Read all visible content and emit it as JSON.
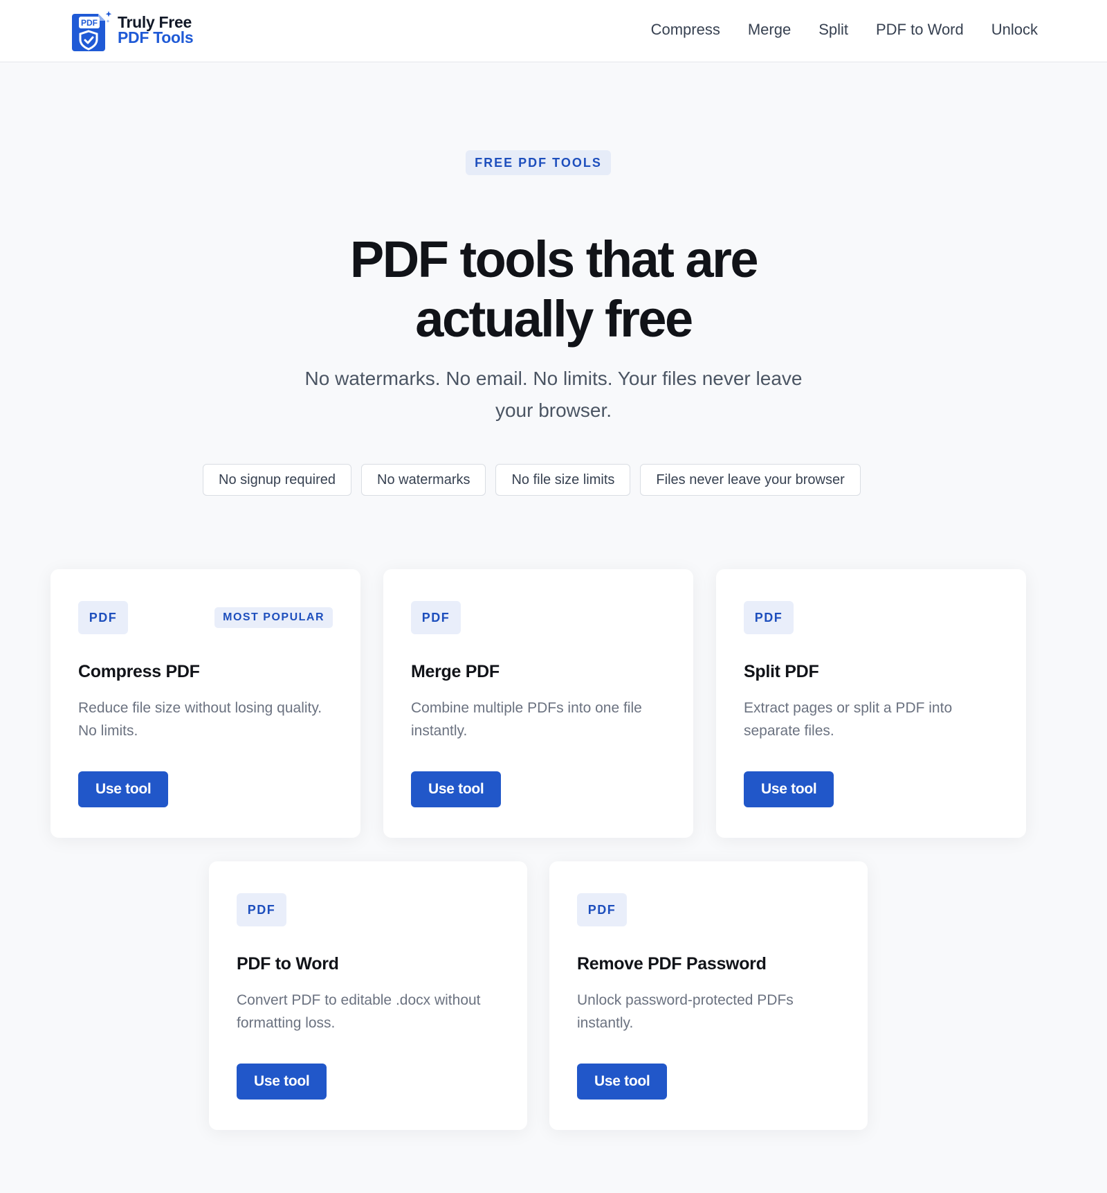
{
  "brand": {
    "logo_badge": "PDF",
    "line1": "Truly Free",
    "line2": "PDF Tools"
  },
  "nav": [
    {
      "label": "Compress"
    },
    {
      "label": "Merge"
    },
    {
      "label": "Split"
    },
    {
      "label": "PDF to Word"
    },
    {
      "label": "Unlock"
    }
  ],
  "hero": {
    "eyebrow": "FREE PDF TOOLS",
    "title_line1": "PDF tools that are",
    "title_line2": "actually free",
    "subtitle_line1": "No watermarks. No email. No limits. Your files never leave",
    "subtitle_line2": "your browser."
  },
  "chips": [
    "No signup required",
    "No watermarks",
    "No file size limits",
    "Files never leave your browser"
  ],
  "tools": [
    {
      "badge": "PDF",
      "tag": "MOST POPULAR",
      "title": "Compress PDF",
      "desc_line1": "Reduce file size without losing quality.",
      "desc_line2": "No limits.",
      "button": "Use tool"
    },
    {
      "badge": "PDF",
      "title": "Merge PDF",
      "desc_line1": "Combine multiple PDFs into one file",
      "desc_line2": "instantly.",
      "button": "Use tool"
    },
    {
      "badge": "PDF",
      "title": "Split PDF",
      "desc_line1": "Extract pages or split a PDF into",
      "desc_line2": "separate files.",
      "button": "Use tool"
    },
    {
      "badge": "PDF",
      "title": "PDF to Word",
      "desc_line1": "Convert PDF to editable .docx without",
      "desc_line2": "formatting loss.",
      "button": "Use tool"
    },
    {
      "badge": "PDF",
      "title": "Remove PDF Password",
      "desc_line1": "Unlock password-protected PDFs",
      "desc_line2": "instantly.",
      "button": "Use tool"
    }
  ],
  "colors": {
    "accent": "#2157c9",
    "badge_bg": "#e9eefa",
    "page_bg": "#f8f9fb"
  }
}
